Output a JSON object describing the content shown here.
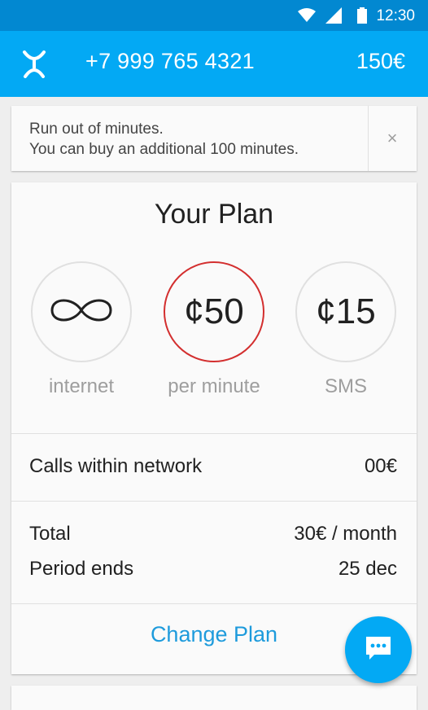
{
  "status_bar": {
    "time": "12:30",
    "wifi_icon": "wifi-icon",
    "signal_icon": "cell-signal-icon",
    "battery_icon": "battery-icon"
  },
  "header": {
    "logo_icon": "yota-logo-icon",
    "phone_number": "+7 999 765 4321",
    "balance": "150€"
  },
  "banner": {
    "line1": "Run out of minutes.",
    "line2": "You can buy an additional 100 minutes.",
    "close_label": "×"
  },
  "plan": {
    "title": "Your Plan",
    "features": [
      {
        "value": "∞",
        "label": "internet",
        "highlight": false
      },
      {
        "value": "¢50",
        "label": "per minute",
        "highlight": true
      },
      {
        "value": "¢15",
        "label": "SMS",
        "highlight": false
      }
    ],
    "calls_label": "Calls within network",
    "calls_value": "00€",
    "total_label": "Total",
    "total_value": "30€ / month",
    "period_label": "Period ends",
    "period_value": "25 dec",
    "change_label": "Change Plan"
  },
  "fab": {
    "icon": "chat-icon"
  },
  "colors": {
    "status_bar": "#0288d1",
    "app_bar": "#03a9f4",
    "accent": "#1e9bdc",
    "highlight_ring": "#d32f2f"
  }
}
